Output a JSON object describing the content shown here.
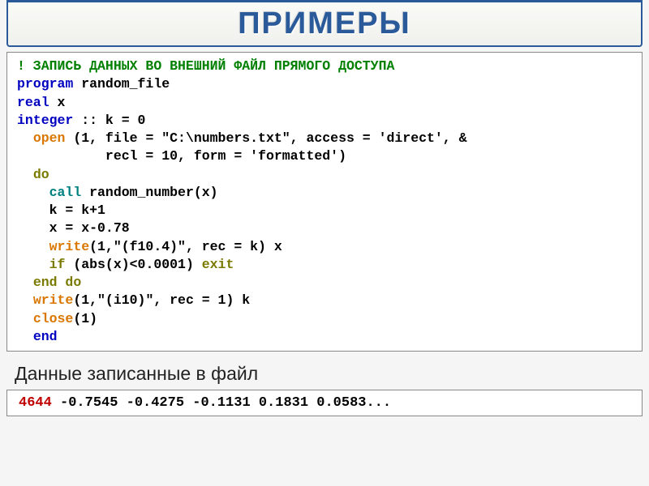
{
  "title": "ПРИМЕРЫ",
  "code": {
    "comment": "! ЗАПИСЬ ДАННЫХ ВО ВНЕШНИЙ ФАЙЛ ПРЯМОГО ДОСТУПА",
    "l1_kw1": "program",
    "l1_name": " random_file",
    "l2_kw1": "real",
    "l2_rest": " x",
    "l3_kw1": "integer",
    "l3_rest": " :: k = 0",
    "l4_indent": "  ",
    "l4_kw": "open",
    "l4_rest": " (1, file = \"C:\\numbers.txt\", access = 'direct', &",
    "l5_rest": "           recl = 10, form = 'formatted')",
    "l6_indent": "  ",
    "l6_kw": "do",
    "l7_indent": "    ",
    "l7_kw": "call",
    "l7_rest": " random_number(x)",
    "l8_rest": "    k = k+1",
    "l9_rest": "    x = x-0.78",
    "l10_indent": "    ",
    "l10_kw": "write",
    "l10_rest": "(1,\"(f10.4)\", rec = k) x",
    "l11_indent": "    ",
    "l11_kw1": "if",
    "l11_mid": " (abs(x)<0.0001) ",
    "l11_kw2": "exit",
    "l12_indent": "  ",
    "l12_kw": "end do",
    "l13_indent": "  ",
    "l13_kw": "write",
    "l13_rest": "(1,\"(i10)\", rec = 1) k",
    "l14_indent": "  ",
    "l14_kw": "close",
    "l14_rest": "(1)",
    "l15_indent": "  ",
    "l15_kw": "end"
  },
  "caption": "Данные записанные в файл",
  "output": {
    "first": "4644",
    "rest": "   -0.7545   -0.4275   -0.1131    0.1831    0.0583..."
  }
}
